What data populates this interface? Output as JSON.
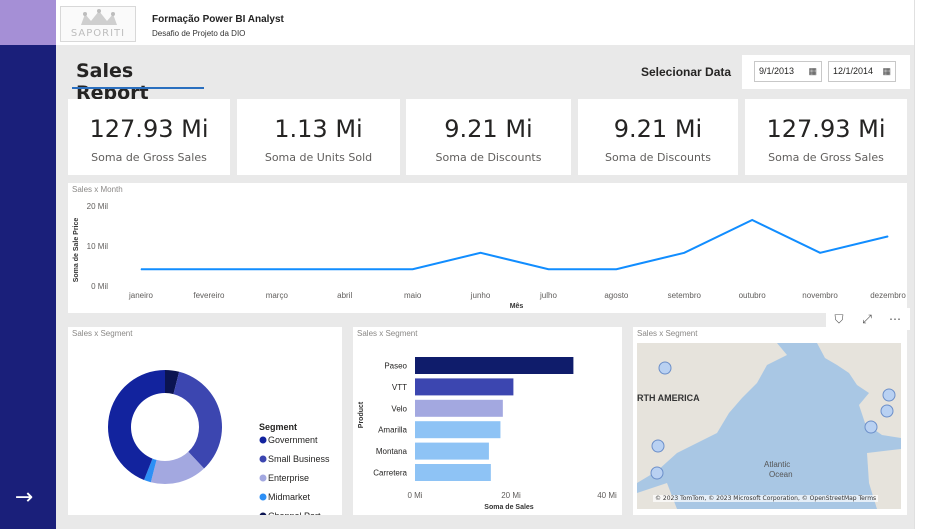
{
  "header": {
    "logo_text": "SAPORITI",
    "brand_title": "Formação Power BI Analyst",
    "brand_subtitle": "Desafio de Projeto da DIO"
  },
  "report": {
    "title": "Sales Report",
    "date_label": "Selecionar Data",
    "date_start": "9/1/2013",
    "date_end": "12/1/2014"
  },
  "kpis": [
    {
      "value": "127.93 Mi",
      "label": "Soma de Gross Sales"
    },
    {
      "value": "1.13 Mi",
      "label": "Soma de Units Sold"
    },
    {
      "value": "9.21 Mi",
      "label": "Soma de Discounts"
    },
    {
      "value": "9.21 Mi",
      "label": "Soma de Discounts"
    },
    {
      "value": "127.93 Mi",
      "label": "Soma de Gross Sales"
    }
  ],
  "line_card": {
    "title": "Sales x Month"
  },
  "donut_card": {
    "title": "Sales x Segment"
  },
  "bar_card": {
    "title": "Sales x Segment"
  },
  "map_card": {
    "title": "Sales x Segment",
    "label_na": "RTH AMERICA",
    "label_ocean1": "Atlantic",
    "label_ocean2": "Ocean",
    "credit": "© 2023 TomTom, © 2023 Microsoft Corporation, © OpenStreetMap Terms"
  },
  "chart_data": [
    {
      "type": "line",
      "title": "Sales x Month",
      "xlabel": "Mês",
      "ylabel": "Soma de Sale Price",
      "yticks": [
        "0 Mil",
        "10 Mil",
        "20 Mil"
      ],
      "ylim": [
        0,
        20
      ],
      "categories": [
        "janeiro",
        "fevereiro",
        "março",
        "abril",
        "maio",
        "junho",
        "julho",
        "agosto",
        "setembro",
        "outubro",
        "novembro",
        "dezembro"
      ],
      "series": [
        {
          "values": [
            4.2,
            4.2,
            4.2,
            4.2,
            4.2,
            8.3,
            4.2,
            4.2,
            8.3,
            16.5,
            8.3,
            12.4
          ],
          "color": "#118dff"
        }
      ],
      "grid": false
    },
    {
      "type": "pie",
      "title": "Sales x Segment",
      "legend_title": "Segment",
      "legend_position": "right",
      "slices": [
        {
          "label": "Government",
          "value": 44,
          "color": "#12239e"
        },
        {
          "label": "Small Business",
          "value": 34,
          "color": "#3c46b0"
        },
        {
          "label": "Enterprise",
          "value": 16,
          "color": "#a3a8e0"
        },
        {
          "label": "Midmarket",
          "value": 2,
          "color": "#2d8ff5"
        },
        {
          "label": "Channel Part...",
          "value": 4,
          "color": "#0b1452"
        }
      ],
      "order_drawn": [
        "Channel Part...",
        "Small Business",
        "Enterprise",
        "Midmarket",
        "Government"
      ]
    },
    {
      "type": "bar",
      "orientation": "horizontal",
      "title": "Sales x Segment",
      "xlabel": "Soma de Sales",
      "ylabel": "Product",
      "categories": [
        "Paseo",
        "VTT",
        "Velo",
        "Amarilla",
        "Montana",
        "Carretera"
      ],
      "values": [
        33,
        20.5,
        18.3,
        17.8,
        15.4,
        15.8
      ],
      "colors": [
        "#0f1c6b",
        "#3c46b0",
        "#a3a8e0",
        "#8ec3f5",
        "#8ec3f5",
        "#8ec3f5"
      ],
      "xticks": [
        "0 Mi",
        "20 Mi",
        "40 Mi"
      ],
      "xlim": [
        0,
        40
      ]
    }
  ]
}
